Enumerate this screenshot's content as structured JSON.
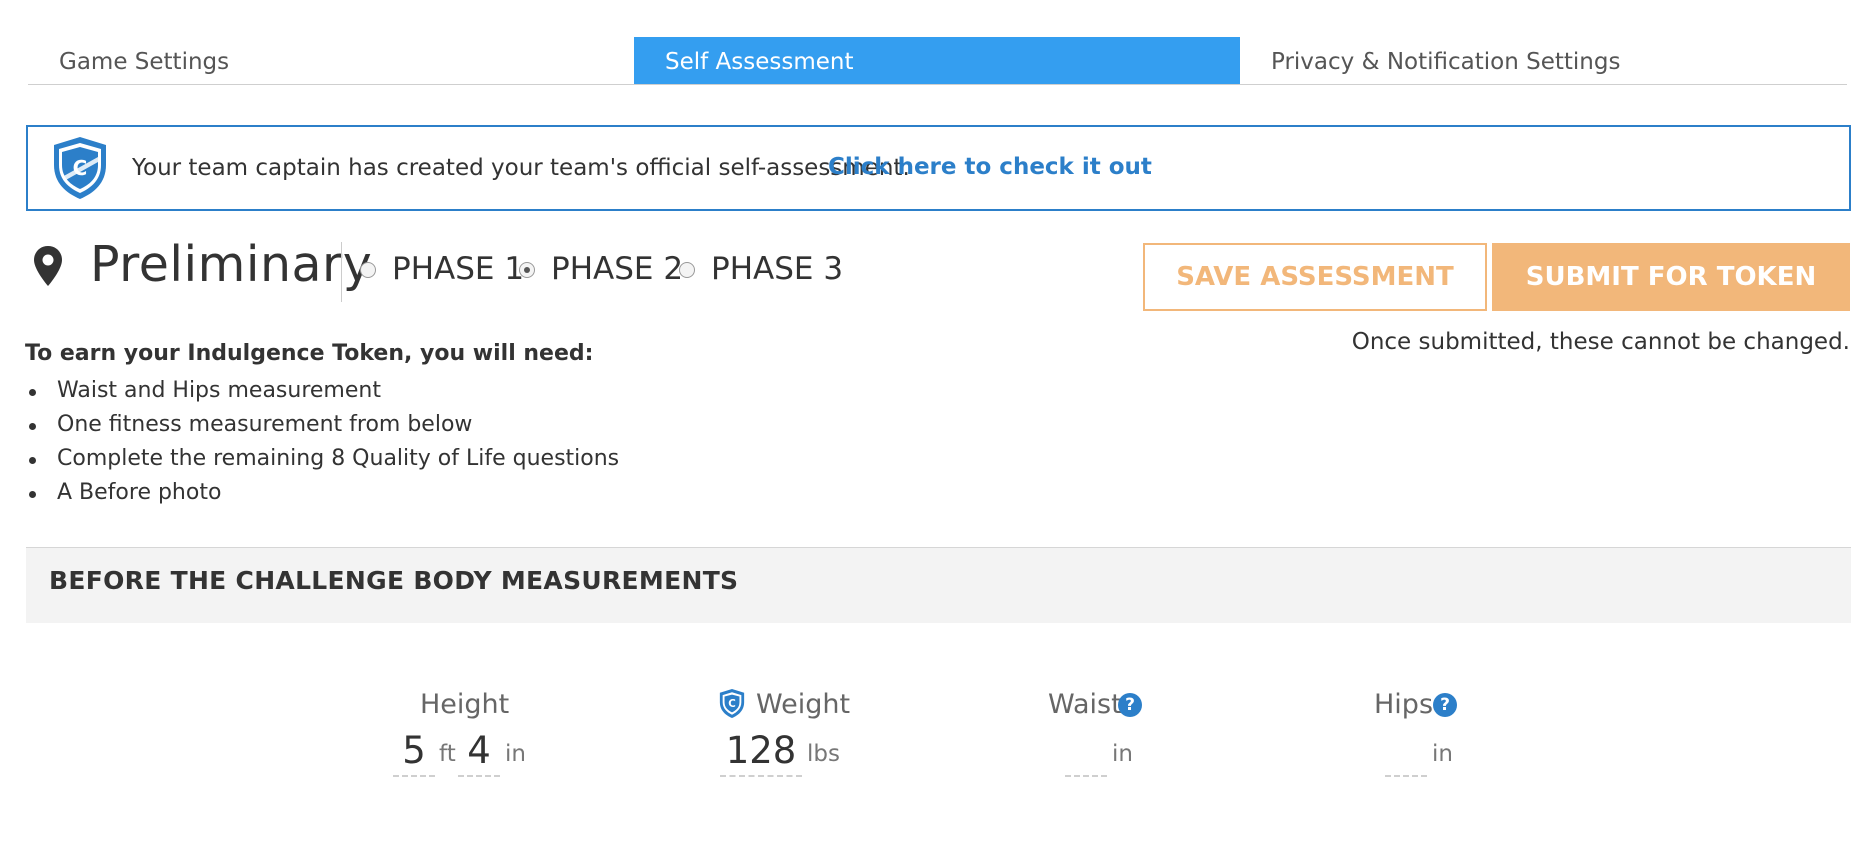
{
  "tabs": [
    {
      "label": "Game Settings",
      "active": false
    },
    {
      "label": "Self Assessment",
      "active": true
    },
    {
      "label": "Privacy & Notification Settings",
      "active": false
    }
  ],
  "banner": {
    "message": "Your team captain has created your team's official self-assessment.",
    "link": "Click here to check it out",
    "icon": "captain-shield-icon",
    "icon_letter": "C"
  },
  "phase": {
    "title": "Preliminary",
    "icon": "map-pin-icon",
    "options": [
      {
        "label": "PHASE 1",
        "checked": false
      },
      {
        "label": "PHASE 2",
        "checked": true
      },
      {
        "label": "PHASE 3",
        "checked": false
      }
    ]
  },
  "actions": {
    "save_label": "SAVE ASSESSMENT",
    "submit_label": "SUBMIT FOR TOKEN",
    "note": "Once submitted, these cannot be changed."
  },
  "requirements": {
    "heading": "To earn your Indulgence Token, you will need:",
    "items": [
      "Waist and Hips measurement",
      "One fitness measurement from below",
      "Complete the remaining 8 Quality of Life questions",
      "A Before photo"
    ]
  },
  "section": {
    "title": "BEFORE THE CHALLENGE BODY MEASUREMENTS"
  },
  "measurements": {
    "height": {
      "label": "Height",
      "feet": "5",
      "feet_unit": "ft",
      "inches": "4",
      "inches_unit": "in"
    },
    "weight": {
      "label": "Weight",
      "value": "128",
      "unit": "lbs",
      "icon": "captain-shield-icon"
    },
    "waist": {
      "label": "Waist",
      "value": "",
      "unit": "in",
      "help": "?"
    },
    "hips": {
      "label": "Hips",
      "value": "",
      "unit": "in",
      "help": "?"
    }
  },
  "colors": {
    "accent": "#349ef0",
    "link": "#2c7fc9",
    "button": "#f2b77a"
  }
}
